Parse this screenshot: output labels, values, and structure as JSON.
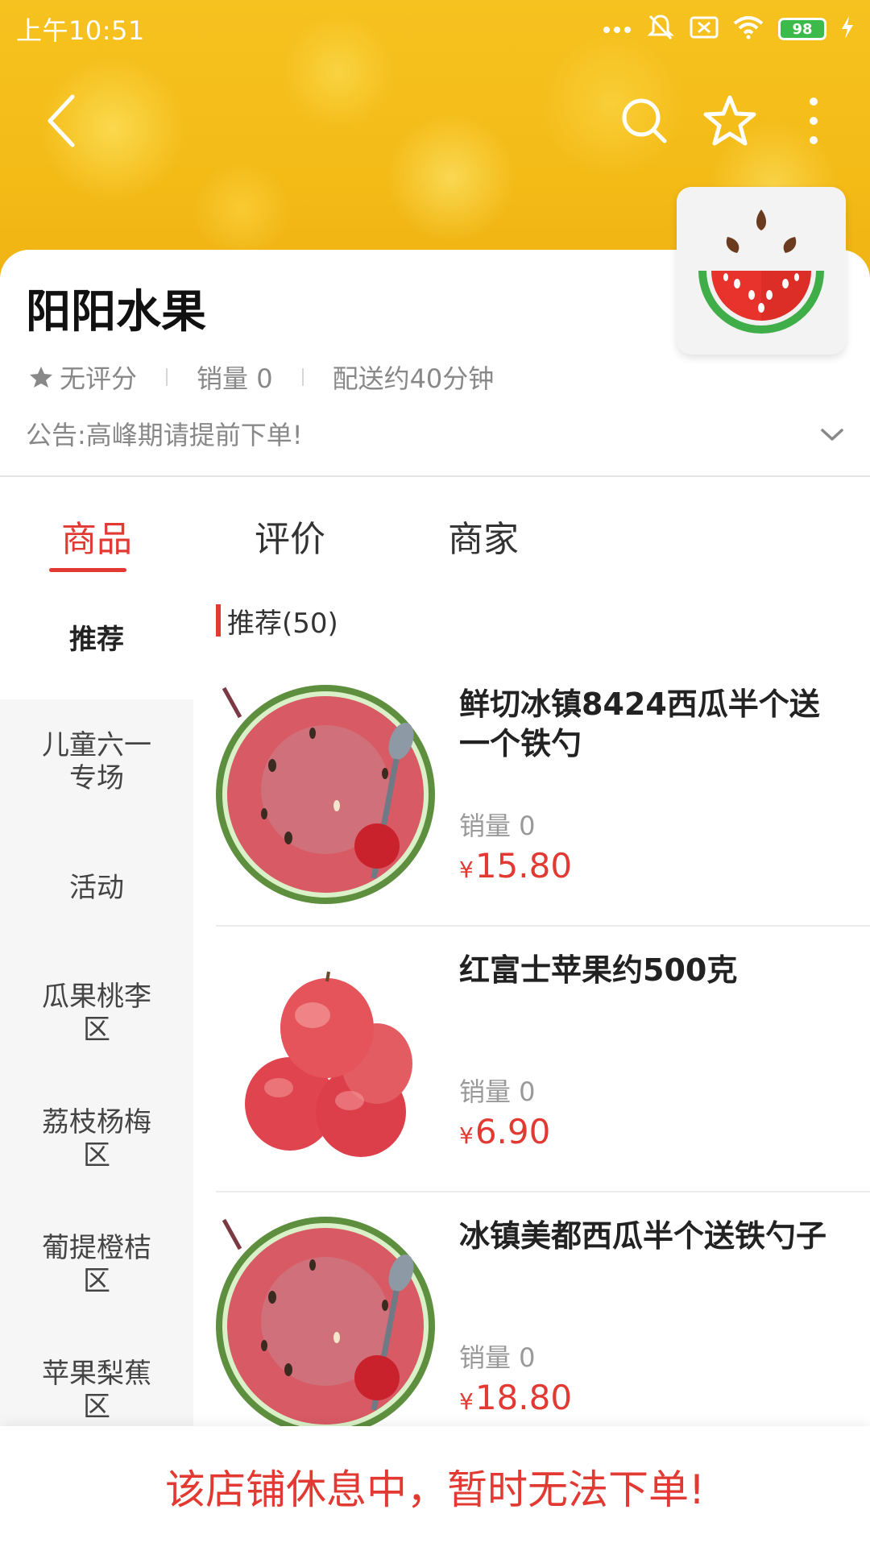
{
  "status_bar": {
    "time": "上午10:51",
    "battery": "98"
  },
  "nav": {
    "back_icon": "back-arrow-icon",
    "search_icon": "search-icon",
    "favorite_icon": "star-outline-icon",
    "more_icon": "more-vertical-icon"
  },
  "shop": {
    "name": "阳阳水果",
    "rating": "无评分",
    "sales": "销量 0",
    "delivery": "配送约40分钟",
    "notice": "公告:高峰期请提前下单!"
  },
  "tabs": [
    {
      "label": "商品"
    },
    {
      "label": "评价"
    },
    {
      "label": "商家"
    }
  ],
  "categories": [
    {
      "label": "推荐"
    },
    {
      "label": "儿童六一专场"
    },
    {
      "label": "活动"
    },
    {
      "label": "瓜果桃李区"
    },
    {
      "label": "荔枝杨梅区"
    },
    {
      "label": "葡提橙桔区"
    },
    {
      "label": "苹果梨蕉区"
    }
  ],
  "section": {
    "title": "推荐(50)"
  },
  "products": [
    {
      "name": "鲜切冰镇8424西瓜半个送一个铁勺",
      "sales": "销量 0",
      "currency": "¥",
      "price": "15.80"
    },
    {
      "name": "红富士苹果约500克",
      "sales": "销量 0",
      "currency": "¥",
      "price": "6.90"
    },
    {
      "name": "冰镇美都西瓜半个送铁勺子",
      "sales": "销量 0",
      "currency": "¥",
      "price": "18.80"
    }
  ],
  "footer": {
    "closed_message": "该店铺休息中，暂时无法下单!"
  },
  "colors": {
    "accent": "#e23a33",
    "banner": "#f6c21f"
  }
}
